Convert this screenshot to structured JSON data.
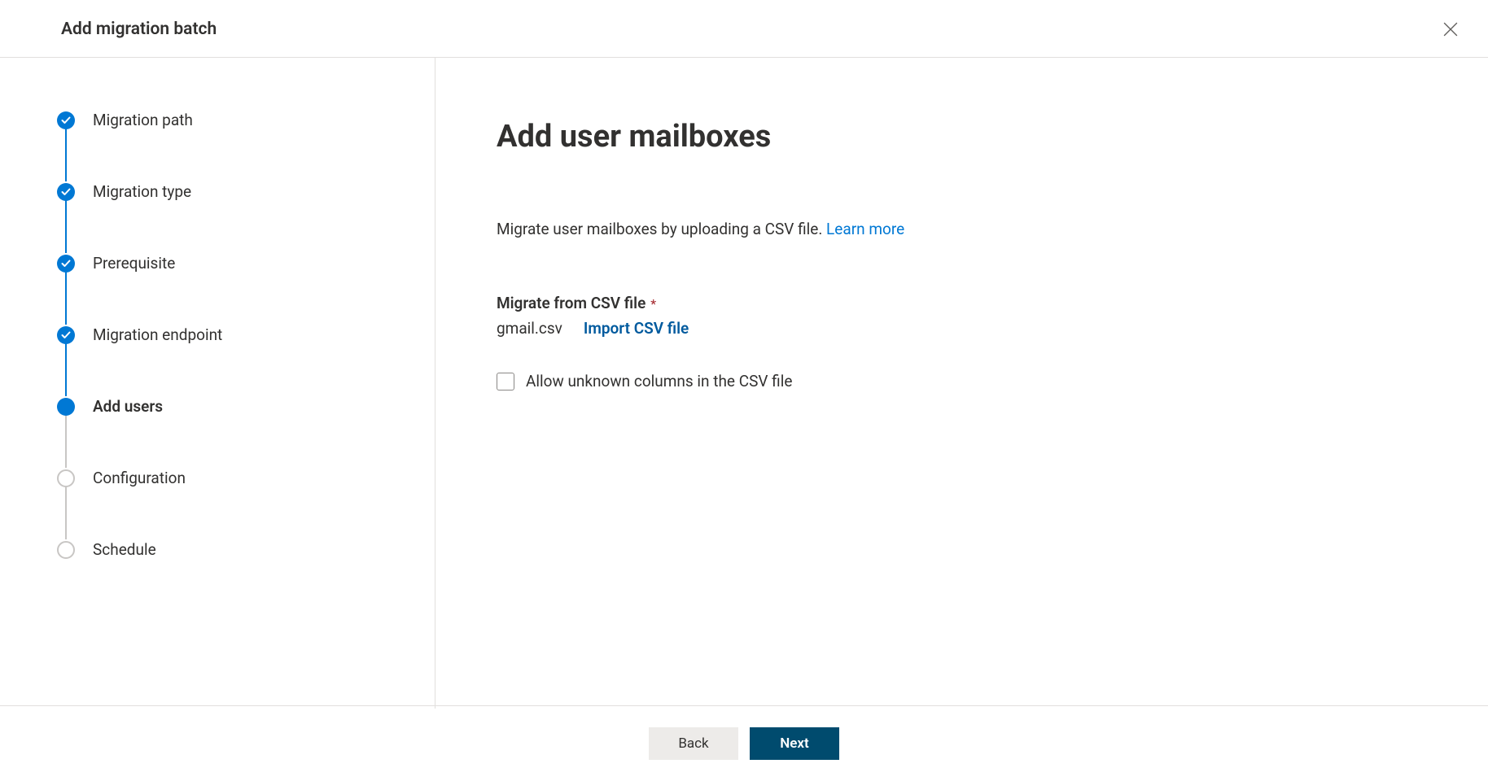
{
  "header": {
    "title": "Add migration batch"
  },
  "sidebar": {
    "steps": [
      {
        "label": "Migration path",
        "state": "completed"
      },
      {
        "label": "Migration type",
        "state": "completed"
      },
      {
        "label": "Prerequisite",
        "state": "completed"
      },
      {
        "label": "Migration endpoint",
        "state": "completed"
      },
      {
        "label": "Add users",
        "state": "current"
      },
      {
        "label": "Configuration",
        "state": "upcoming"
      },
      {
        "label": "Schedule",
        "state": "upcoming"
      }
    ]
  },
  "content": {
    "title": "Add user mailboxes",
    "description": "Migrate user mailboxes by uploading a CSV file. ",
    "learn_more": "Learn more",
    "csv_field_label": "Migrate from CSV file",
    "filename": "gmail.csv",
    "import_link": "Import CSV file",
    "checkbox_label": "Allow unknown columns in the CSV file"
  },
  "footer": {
    "back": "Back",
    "next": "Next"
  }
}
